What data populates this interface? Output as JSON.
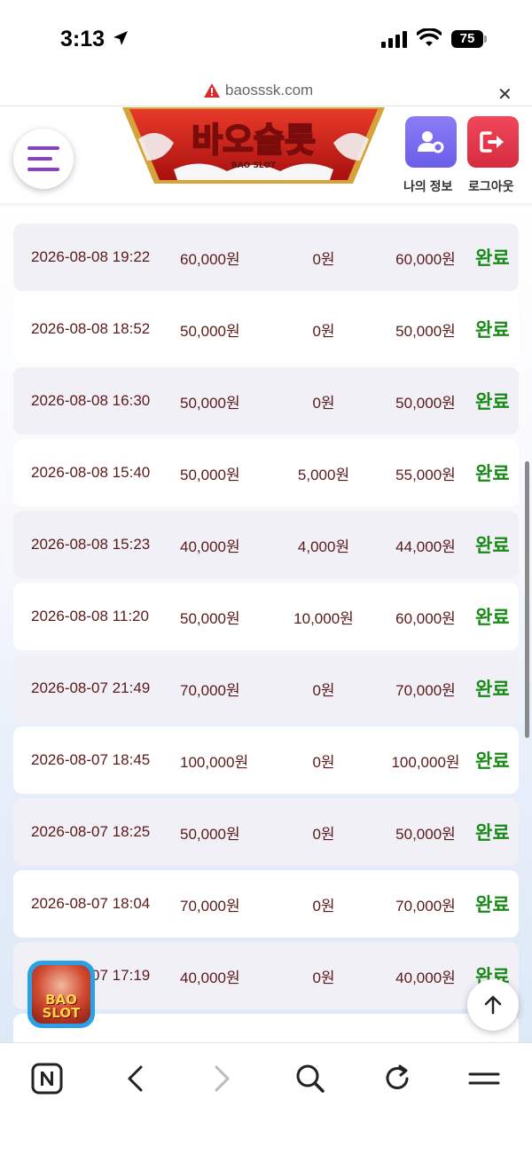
{
  "status_bar": {
    "time": "3:13",
    "battery": "75"
  },
  "browser": {
    "url": "baosssk.com"
  },
  "header": {
    "logo_text": "바오슬롯",
    "logo_sub": "BAO SLOT",
    "my_info_label": "나의 정보",
    "logout_label": "로그아웃"
  },
  "rows": [
    {
      "date": "2026-08-08 19:22",
      "amount": "60,000원",
      "bonus": "0원",
      "total": "60,000원",
      "status": "완료"
    },
    {
      "date": "2026-08-08 18:52",
      "amount": "50,000원",
      "bonus": "0원",
      "total": "50,000원",
      "status": "완료"
    },
    {
      "date": "2026-08-08 16:30",
      "amount": "50,000원",
      "bonus": "0원",
      "total": "50,000원",
      "status": "완료"
    },
    {
      "date": "2026-08-08 15:40",
      "amount": "50,000원",
      "bonus": "5,000원",
      "total": "55,000원",
      "status": "완료"
    },
    {
      "date": "2026-08-08 15:23",
      "amount": "40,000원",
      "bonus": "4,000원",
      "total": "44,000원",
      "status": "완료"
    },
    {
      "date": "2026-08-08 11:20",
      "amount": "50,000원",
      "bonus": "10,000원",
      "total": "60,000원",
      "status": "완료"
    },
    {
      "date": "2026-08-07 21:49",
      "amount": "70,000원",
      "bonus": "0원",
      "total": "70,000원",
      "status": "완료"
    },
    {
      "date": "2026-08-07 18:45",
      "amount": "100,000원",
      "bonus": "0원",
      "total": "100,000원",
      "status": "완료"
    },
    {
      "date": "2026-08-07 18:25",
      "amount": "50,000원",
      "bonus": "0원",
      "total": "50,000원",
      "status": "완료"
    },
    {
      "date": "2026-08-07 18:04",
      "amount": "70,000원",
      "bonus": "0원",
      "total": "70,000원",
      "status": "완료"
    },
    {
      "date": "2026-08-07 17:19",
      "amount": "40,000원",
      "bonus": "0원",
      "total": "40,000원",
      "status": "완료"
    }
  ],
  "float_logo": {
    "line1": "BAO",
    "line2": "SLOT"
  },
  "colors": {
    "accent_purple": "#8a3fc9",
    "status_green": "#178a17",
    "amount_text": "#5a1a1a"
  }
}
